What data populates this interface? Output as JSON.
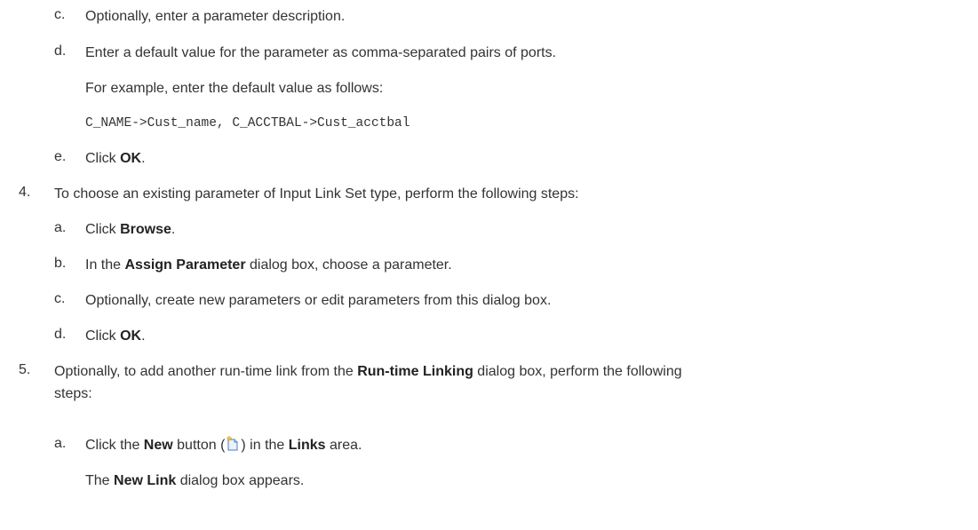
{
  "doc": {
    "c_opt": {
      "marker": "c.",
      "text": "Optionally, enter a parameter description."
    },
    "d_default": {
      "marker": "d.",
      "text": "Enter a default value for the parameter as comma-separated pairs of ports."
    },
    "example_intro": "For example, enter the default value as follows:",
    "code": "C_NAME->Cust_name, C_ACCTBAL->Cust_acctbal",
    "e_ok": {
      "marker": "e.",
      "pre": "Click ",
      "bold": "OK",
      "post": "."
    },
    "step4": {
      "marker": "4.",
      "text": "To choose an existing parameter of Input Link Set type, perform the following steps:"
    },
    "s4a": {
      "marker": "a.",
      "pre": "Click ",
      "bold": "Browse",
      "post": "."
    },
    "s4b": {
      "marker": "b.",
      "pre": "In the ",
      "bold": "Assign Parameter",
      "post": " dialog box, choose a parameter."
    },
    "s4c": {
      "marker": "c.",
      "text": "Optionally, create new parameters or edit parameters from this dialog box."
    },
    "s4d": {
      "marker": "d.",
      "pre": "Click ",
      "bold": "OK",
      "post": "."
    },
    "step5": {
      "marker": "5.",
      "pre": "Optionally, to add another run-time link from the ",
      "bold": "Run-time Linking",
      "post": " dialog box, perform the following",
      "line2": "steps:"
    },
    "s5a": {
      "marker": "a.",
      "pre": "Click the ",
      "bold1": "New",
      "mid": " button (",
      "icon": "new-document-icon",
      "mid2": ") in the ",
      "bold2": "Links",
      "post": " area."
    },
    "s5a_note": {
      "pre": "The ",
      "bold": "New Link",
      "post": " dialog box appears."
    }
  }
}
